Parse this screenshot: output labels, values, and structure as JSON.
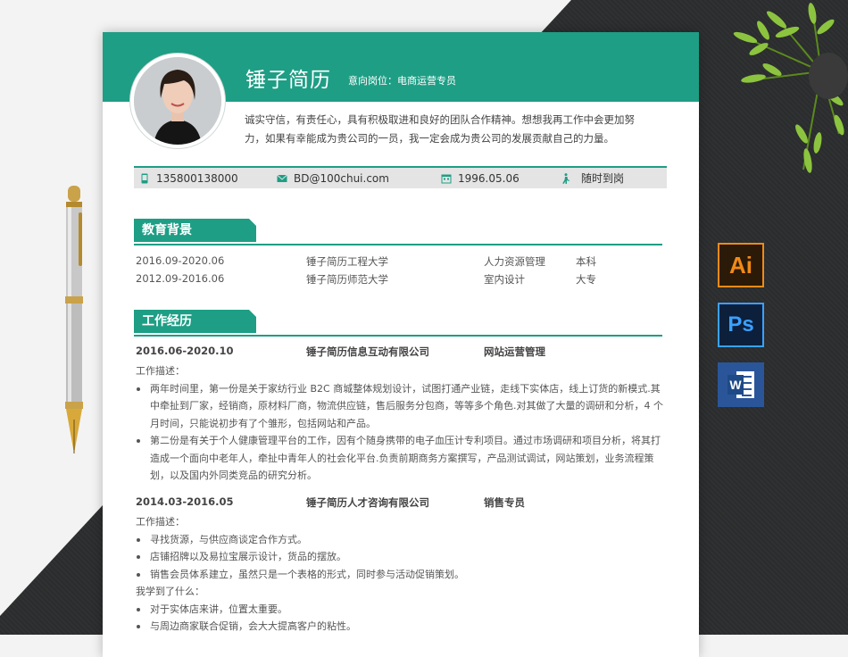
{
  "resume": {
    "name": "锤子简历",
    "intent": "意向岗位：电商运营专员",
    "summary": "诚实守信，有责任心，具有积极取进和良好的团队合作精神。想想我再工作中会更加努力，如果有幸能成为贵公司的一员，我一定会成为贵公司的发展贡献自己的力量。",
    "contact": {
      "phone": "135800138000",
      "email": "BD@100chui.com",
      "birth": "1996.05.06",
      "availability": "随时到岗"
    },
    "education": {
      "title": "教育背景",
      "rows": [
        {
          "period": "2016.09-2020.06",
          "school": "锤子简历工程大学",
          "major": "人力资源管理",
          "degree": "本科"
        },
        {
          "period": "2012.09-2016.06",
          "school": "锤子简历师范大学",
          "major": "室内设计",
          "degree": "大专"
        }
      ]
    },
    "work": {
      "title": "工作经历",
      "jobs": [
        {
          "period": "2016.06-2020.10",
          "company": "锤子简历信息互动有限公司",
          "position": "网站运营管理",
          "desc_label": "工作描述：",
          "bullets": [
            "两年时间里，第一份是关于家纺行业 B2C 商城整体规划设计，试图打通产业链，走线下实体店，线上订货的新模式.其中牵扯到厂家，经销商，原材料厂商，物流供应链，售后服务分包商，等等多个角色.对其做了大量的调研和分析，4 个月时间，只能说初步有了个雏形，包括网站和产品。",
            "第二份是有关于个人健康管理平台的工作，因有个随身携带的电子血压计专利项目。通过市场调研和项目分析，将其打造成一个面向中老年人，牵扯中青年人的社会化平台.负责前期商务方案撰写，产品测试调试，网站策划，业务流程策划，以及国内外同类竞品的研究分析。"
          ]
        },
        {
          "period": "2014.03-2016.05",
          "company": "锤子简历人才咨询有限公司",
          "position": "销售专员",
          "desc_label": "工作描述：",
          "bullets": [
            "寻找货源，与供应商谈定合作方式。",
            "店铺招牌以及易拉宝展示设计，货品的摆放。",
            "销售会员体系建立，虽然只是一个表格的形式，同时参与活动促销策划。"
          ],
          "learned_label": "我学到了什么：",
          "learned": [
            "对于实体店来讲，位置太重要。",
            "与周边商家联合促销，会大大提高客户的粘性。"
          ]
        }
      ]
    }
  },
  "software_icons": [
    "Ai",
    "Ps",
    "W"
  ],
  "colors": {
    "accent": "#1e9e85",
    "dark_bg": "#2b2d2e"
  }
}
